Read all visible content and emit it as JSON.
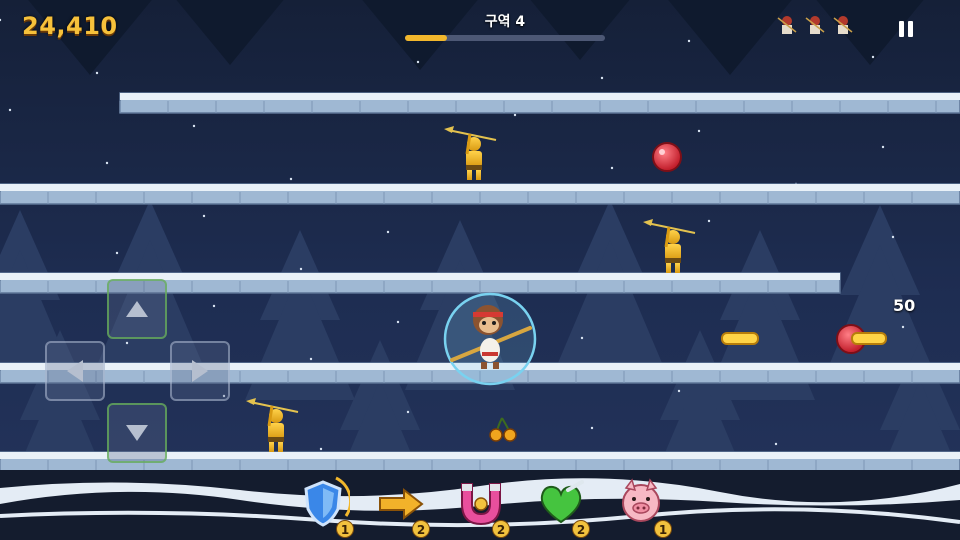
{
  "hud": {
    "score": "24,410",
    "zone_label": "구역 4",
    "zone_progress_fraction": 0.21,
    "lives_remaining": 3
  },
  "popups": {
    "points_popup": "50"
  },
  "powerups": [
    {
      "name": "shield",
      "icon": "shield-icon",
      "count": "1"
    },
    {
      "name": "dash",
      "icon": "arrow-right-icon",
      "count": "2"
    },
    {
      "name": "magnet",
      "icon": "magnet-icon",
      "count": "2"
    },
    {
      "name": "heart",
      "icon": "winged-heart-icon",
      "count": "2"
    },
    {
      "name": "pig",
      "icon": "pig-face-icon",
      "count": "1"
    }
  ],
  "controls": {
    "dpad": [
      "up",
      "down",
      "left",
      "right"
    ]
  },
  "colors": {
    "score_gold": "#f6c13b",
    "progress_fill": "#f2b72c",
    "sky": "#1e2d52",
    "ice_platform": "#a9c2dc"
  }
}
